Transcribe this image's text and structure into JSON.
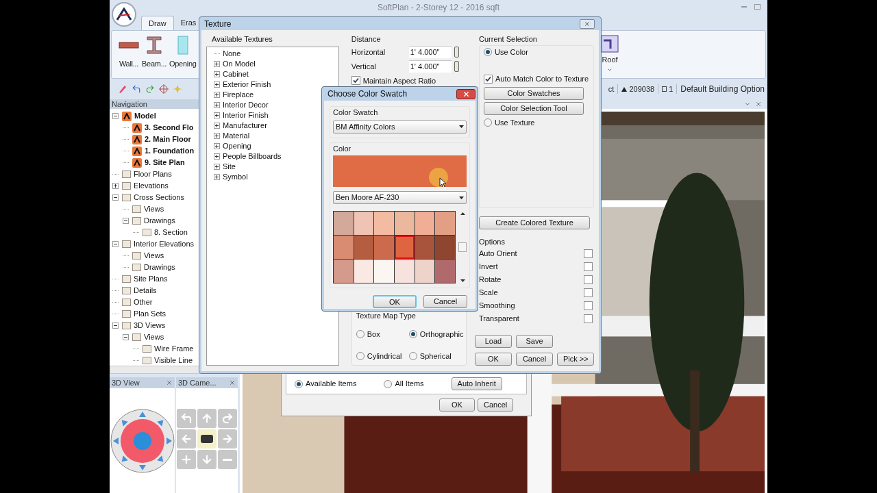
{
  "window": {
    "title": "SoftPlan - 2-Storey 12 - 2016 sqft"
  },
  "ribbon": {
    "tabs": [
      {
        "label": "Draw",
        "selected": true
      },
      {
        "label": "Eras",
        "selected": false
      }
    ],
    "buttons": [
      {
        "label": "Wall...",
        "kind": "wall"
      },
      {
        "label": "Beam...",
        "kind": "beam"
      },
      {
        "label": "Opening",
        "kind": "opening"
      }
    ],
    "right_button": {
      "label": "Roof"
    }
  },
  "toolbar": {
    "status": [
      {
        "label": "ct",
        "kind": "text"
      },
      {
        "label": "209038",
        "kind": "triangle"
      },
      {
        "label": "1",
        "kind": "square"
      }
    ],
    "building_option": "Default Building Option"
  },
  "navigation": {
    "title": "Navigation",
    "tree": [
      {
        "label": "Model",
        "kind": "group",
        "expanded": true,
        "bold": true,
        "children": [
          {
            "label": "3. Second Flo",
            "kind": "leaf",
            "bold": true
          },
          {
            "label": "2. Main Floor",
            "kind": "leaf",
            "bold": true
          },
          {
            "label": "1. Foundation",
            "kind": "leaf",
            "bold": true
          },
          {
            "label": "9. Site Plan",
            "kind": "leaf",
            "bold": true
          }
        ]
      },
      {
        "label": "Floor Plans",
        "kind": "leaf",
        "bold": false
      },
      {
        "label": "Elevations",
        "kind": "group",
        "expanded": false,
        "bold": false
      },
      {
        "label": "Cross Sections",
        "kind": "group",
        "expanded": true,
        "bold": false,
        "children": [
          {
            "label": "Views",
            "kind": "leaf",
            "bold": false
          },
          {
            "label": "Drawings",
            "kind": "group",
            "expanded": true,
            "bold": false,
            "children": [
              {
                "label": "8. Section",
                "kind": "leaf",
                "bold": false
              }
            ]
          }
        ]
      },
      {
        "label": "Interior Elevations",
        "kind": "group",
        "expanded": true,
        "bold": false,
        "children": [
          {
            "label": "Views",
            "kind": "leaf",
            "bold": false
          },
          {
            "label": "Drawings",
            "kind": "leaf",
            "bold": false
          }
        ]
      },
      {
        "label": "Site Plans",
        "kind": "leaf",
        "bold": false
      },
      {
        "label": "Details",
        "kind": "leaf",
        "bold": false
      },
      {
        "label": "Other",
        "kind": "leaf",
        "bold": false
      },
      {
        "label": "Plan Sets",
        "kind": "leaf",
        "bold": false
      },
      {
        "label": "3D Views",
        "kind": "group",
        "expanded": true,
        "bold": false,
        "children": [
          {
            "label": "Views",
            "kind": "group",
            "expanded": true,
            "bold": false,
            "children": [
              {
                "label": "Wire Frame",
                "kind": "leaf",
                "bold": false
              },
              {
                "label": "Visible Line",
                "kind": "leaf",
                "bold": false
              }
            ]
          }
        ]
      }
    ]
  },
  "panels": [
    {
      "title": "3D View",
      "kind": "joystick"
    },
    {
      "title": "3D Came...",
      "kind": "camera"
    }
  ],
  "background_dialog": {
    "options": [
      {
        "label": "Available Items",
        "selected": true
      },
      {
        "label": "All Items",
        "selected": false
      }
    ],
    "inherit_button": "Auto Inherit",
    "buttons": [
      "OK",
      "Cancel"
    ]
  },
  "texture_dialog": {
    "title": "Texture",
    "available_label": "Available Textures",
    "textures": [
      {
        "label": "None",
        "kind": "leaf"
      },
      {
        "label": "On Model",
        "kind": "group",
        "expanded": false
      },
      {
        "label": "Cabinet",
        "kind": "group",
        "expanded": false
      },
      {
        "label": "Exterior Finish",
        "kind": "group",
        "expanded": false
      },
      {
        "label": "Fireplace",
        "kind": "group",
        "expanded": false
      },
      {
        "label": "Interior Decor",
        "kind": "group",
        "expanded": false
      },
      {
        "label": "Interior Finish",
        "kind": "group",
        "expanded": false
      },
      {
        "label": "Manufacturer",
        "kind": "group",
        "expanded": false
      },
      {
        "label": "Material",
        "kind": "group",
        "expanded": false
      },
      {
        "label": "Opening",
        "kind": "group",
        "expanded": false
      },
      {
        "label": "People Billboards",
        "kind": "group",
        "expanded": false
      },
      {
        "label": "Site",
        "kind": "group",
        "expanded": false
      },
      {
        "label": "Symbol",
        "kind": "group",
        "expanded": false
      }
    ],
    "distance": {
      "title": "Distance",
      "fields": [
        {
          "label": "Horizontal",
          "value": "1' 4.000''"
        },
        {
          "label": "Vertical",
          "value": "1' 4.000''"
        }
      ],
      "maintain": {
        "label": "Maintain Aspect Ratio",
        "checked": true
      }
    },
    "map_type": {
      "title": "Texture Map Type",
      "options": [
        {
          "label": "Box",
          "selected": false
        },
        {
          "label": "Orthographic",
          "selected": true
        },
        {
          "label": "Cylindrical",
          "selected": false
        },
        {
          "label": "Spherical",
          "selected": false
        }
      ]
    },
    "current_selection": {
      "title": "Current Selection",
      "use_color": {
        "label": "Use Color",
        "selected": true
      },
      "auto_match": {
        "label": "Auto Match Color to Texture",
        "checked": true
      },
      "buttons": [
        "Color Swatches",
        "Color Selection Tool"
      ],
      "use_texture": {
        "label": "Use Texture",
        "selected": false
      }
    },
    "create_button": "Create Colored Texture",
    "options": {
      "title": "Options",
      "items": [
        {
          "label": "Auto Orient",
          "checked": false
        },
        {
          "label": "Invert",
          "checked": false
        },
        {
          "label": "Rotate",
          "checked": false
        },
        {
          "label": "Scale",
          "checked": false
        },
        {
          "label": "Smoothing",
          "checked": false
        },
        {
          "label": "Transparent",
          "checked": false
        }
      ]
    },
    "file_buttons": [
      "Load",
      "Save"
    ],
    "buttons": [
      "OK",
      "Cancel",
      "Pick >>"
    ]
  },
  "color_dialog": {
    "title": "Choose Color Swatch",
    "swatch_label": "Color Swatch",
    "swatch_set": "BM Affinity Colors",
    "color_label": "Color",
    "color": "#df6c45",
    "color_name": "Ben Moore AF-230",
    "swatches": [
      {
        "color": "#d3a99c",
        "selected": false
      },
      {
        "color": "#f0c4b4",
        "selected": false
      },
      {
        "color": "#f3bba2",
        "selected": false
      },
      {
        "color": "#ebb89e",
        "selected": false
      },
      {
        "color": "#efae95",
        "selected": false
      },
      {
        "color": "#e39f84",
        "selected": false
      },
      {
        "color": "#d98c72",
        "selected": false
      },
      {
        "color": "#b45d40",
        "selected": false
      },
      {
        "color": "#cc6a4e",
        "selected": false
      },
      {
        "color": "#df6541",
        "selected": true
      },
      {
        "color": "#a8543c",
        "selected": false
      },
      {
        "color": "#8e4631",
        "selected": false
      },
      {
        "color": "#d49a8c",
        "selected": false
      },
      {
        "color": "#fae8e2",
        "selected": false
      },
      {
        "color": "#fcf6f2",
        "selected": false
      },
      {
        "color": "#f8e2de",
        "selected": false
      },
      {
        "color": "#eed3cb",
        "selected": false
      },
      {
        "color": "#b06a6c",
        "selected": false
      }
    ],
    "buttons": [
      "OK",
      "Cancel"
    ]
  }
}
